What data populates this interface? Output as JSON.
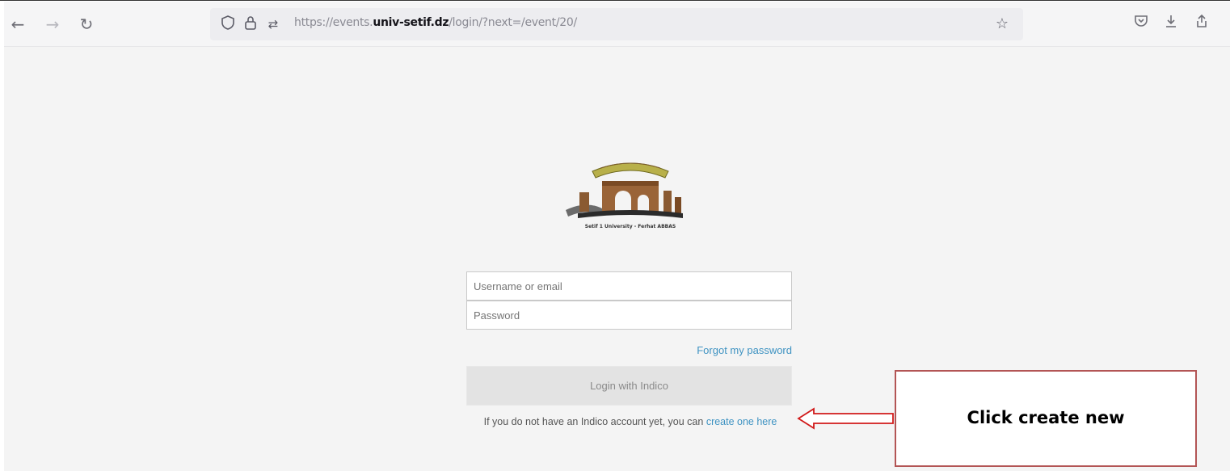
{
  "browser": {
    "url_prefix": "https://events.",
    "url_domain": "univ-setif.dz",
    "url_path": "/login/?next=/event/20/",
    "icons": [
      "back-arrow-icon",
      "forward-arrow-icon",
      "reload-icon",
      "shield-icon",
      "lock-icon",
      "permissions-icon",
      "bookmark-star-icon",
      "pocket-icon",
      "download-icon",
      "share-icon"
    ]
  },
  "logo": {
    "caption": "Setif 1 University - Ferhat ABBAS"
  },
  "login": {
    "username_placeholder": "Username or email",
    "password_placeholder": "Password",
    "forgot_label": "Forgot my password",
    "login_button": "Login with Indico",
    "info_text": "If you do not have an Indico account yet, you can",
    "create_link": "create one here"
  },
  "annotation": {
    "callout_text": "Click create new",
    "colors": {
      "border": "#b35555",
      "arrow": "#d11a1a"
    }
  }
}
